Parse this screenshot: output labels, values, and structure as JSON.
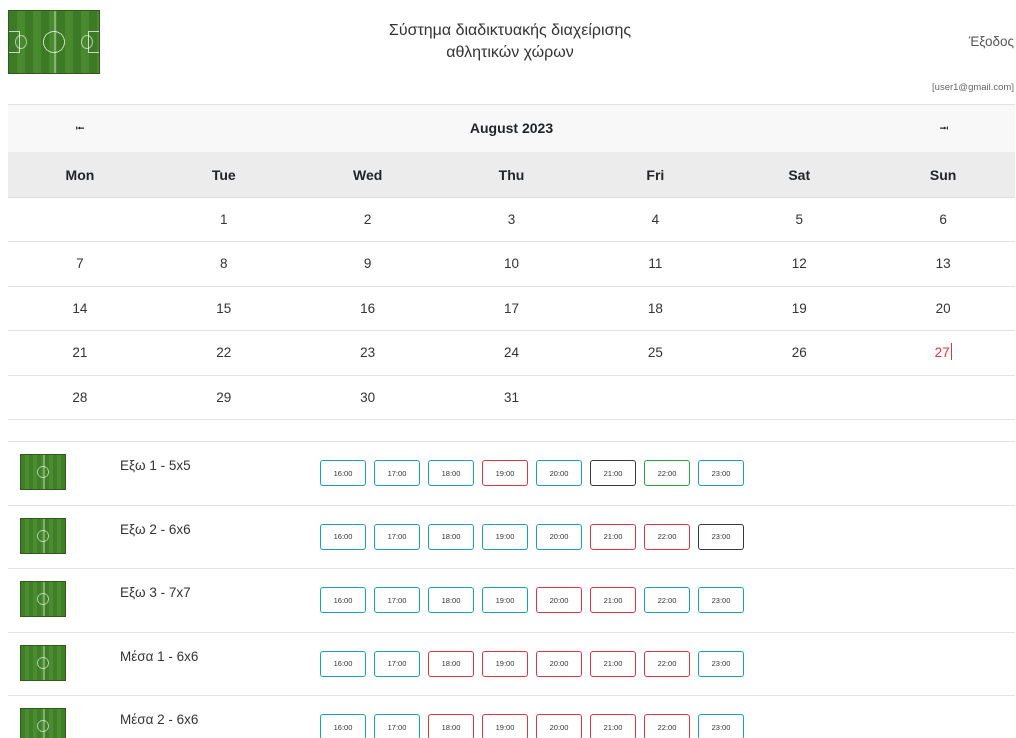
{
  "header": {
    "title_line1": "Σύστημα διαδικτυακής διαχείρισης",
    "title_line2": "αθλητικών χώρων",
    "logout": "Έξοδος",
    "user": "[user1@gmail.com]"
  },
  "calendar": {
    "prev_icon": "⭾",
    "next_icon": "⭾",
    "month": "August 2023",
    "days": [
      "Mon",
      "Tue",
      "Wed",
      "Thu",
      "Fri",
      "Sat",
      "Sun"
    ],
    "weeks": [
      [
        "",
        "1",
        "2",
        "3",
        "4",
        "5",
        "6"
      ],
      [
        "7",
        "8",
        "9",
        "10",
        "11",
        "12",
        "13"
      ],
      [
        "14",
        "15",
        "16",
        "17",
        "18",
        "19",
        "20"
      ],
      [
        "21",
        "22",
        "23",
        "24",
        "25",
        "26",
        "27"
      ],
      [
        "28",
        "29",
        "30",
        "31",
        "",
        "",
        ""
      ]
    ],
    "today": "27",
    "colors": {
      "today": "#dc3545"
    }
  },
  "fields": [
    {
      "name": "Εξω 1 - 5x5",
      "slots": [
        "16:00",
        "17:00",
        "18:00",
        "19:00",
        "20:00",
        "21:00",
        "22:00",
        "23:00"
      ],
      "states": [
        "free",
        "free",
        "free",
        "booked",
        "free",
        "mine",
        "green",
        "free"
      ]
    },
    {
      "name": "Εξω 2 - 6x6",
      "slots": [
        "16:00",
        "17:00",
        "18:00",
        "19:00",
        "20:00",
        "21:00",
        "22:00",
        "23:00"
      ],
      "states": [
        "free",
        "free",
        "free",
        "free",
        "free",
        "booked",
        "booked",
        "mine"
      ]
    },
    {
      "name": "Εξω 3 - 7x7",
      "slots": [
        "16:00",
        "17:00",
        "18:00",
        "19:00",
        "20:00",
        "21:00",
        "22:00",
        "23:00"
      ],
      "states": [
        "free",
        "free",
        "free",
        "free",
        "booked",
        "booked",
        "free",
        "free"
      ]
    },
    {
      "name": "Μέσα 1 - 6x6",
      "slots": [
        "16:00",
        "17:00",
        "18:00",
        "19:00",
        "20:00",
        "21:00",
        "22:00",
        "23:00"
      ],
      "states": [
        "free",
        "free",
        "booked",
        "booked",
        "booked",
        "booked",
        "booked",
        "free"
      ]
    },
    {
      "name": "Μέσα 2 - 6x6",
      "slots": [
        "16:00",
        "17:00",
        "18:00",
        "19:00",
        "20:00",
        "21:00",
        "22:00",
        "23:00"
      ],
      "states": [
        "free",
        "free",
        "booked",
        "booked",
        "booked",
        "booked",
        "booked",
        "free"
      ]
    }
  ],
  "slot_colors": {
    "free": "#17a2b8",
    "booked": "#dc3545",
    "mine": "#343a40",
    "green": "#28a745"
  }
}
